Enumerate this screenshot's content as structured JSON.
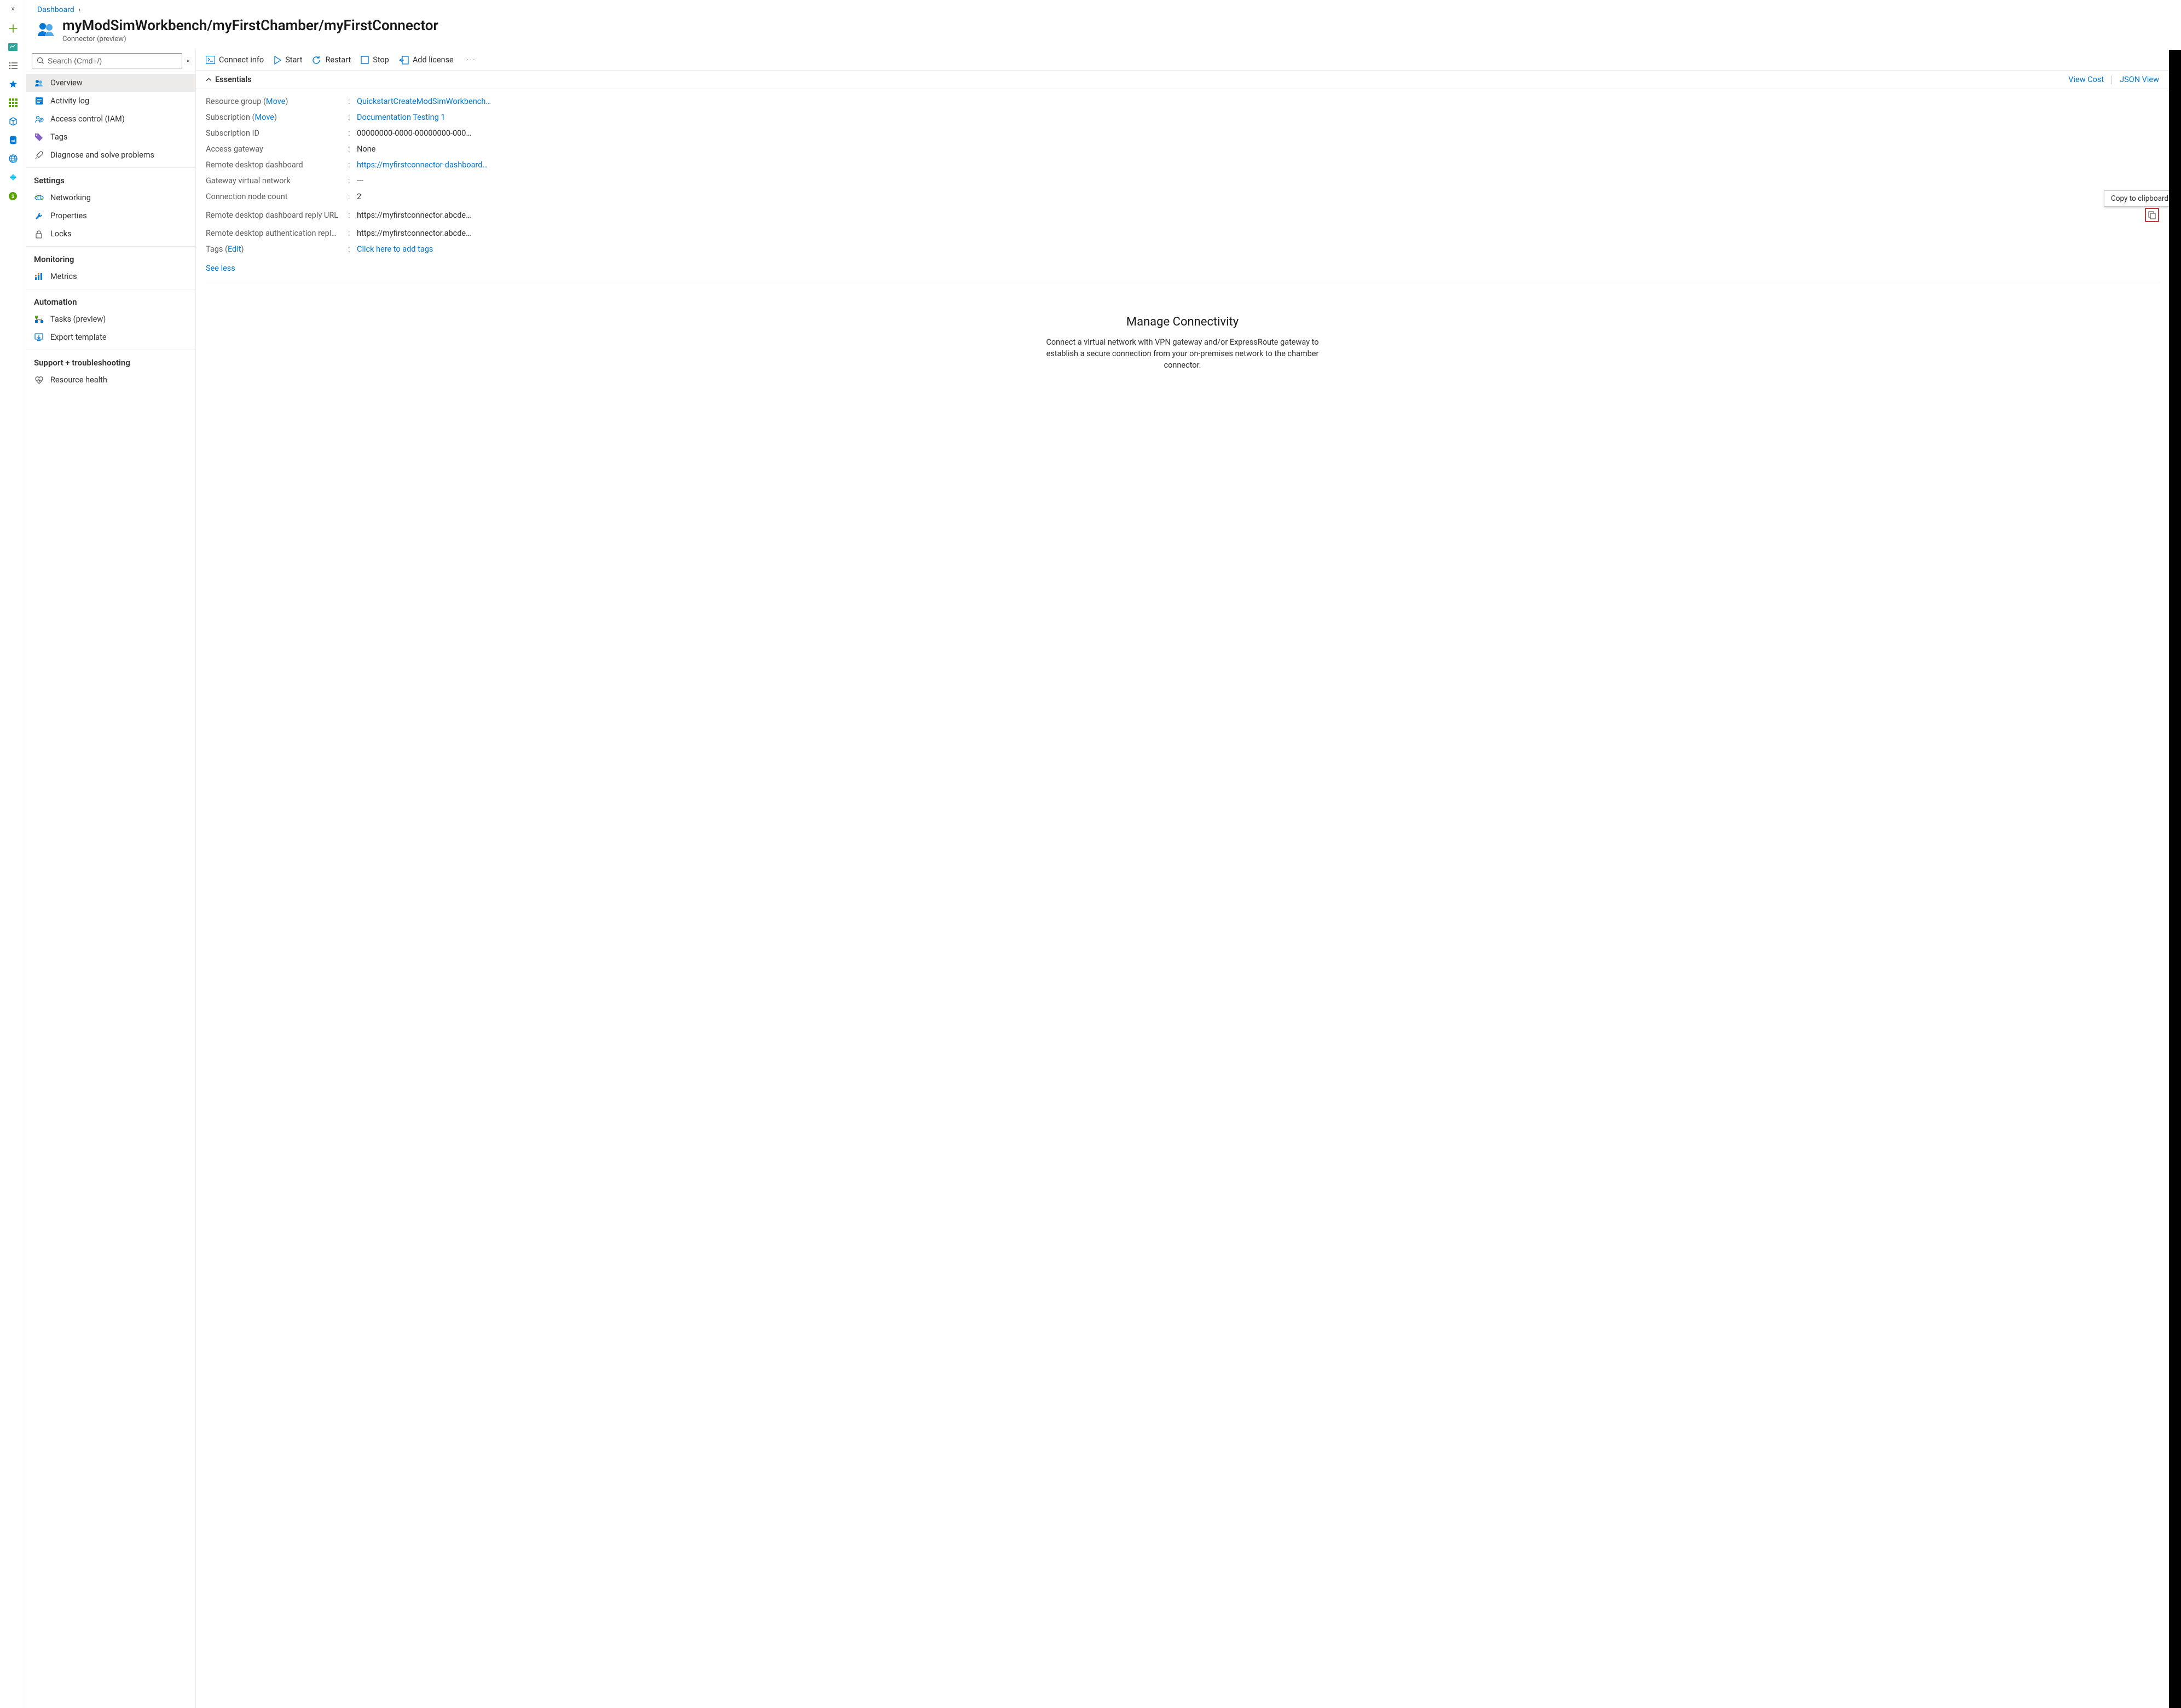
{
  "breadcrumb": {
    "root": "Dashboard"
  },
  "header": {
    "title": "myModSimWorkbench/myFirstChamber/myFirstConnector",
    "subtitle": "Connector (preview)"
  },
  "search": {
    "placeholder": "Search (Cmd+/)"
  },
  "sidebar": {
    "items_top": [
      {
        "label": "Overview",
        "icon": "overview",
        "active": true
      },
      {
        "label": "Activity log",
        "icon": "activity"
      },
      {
        "label": "Access control (IAM)",
        "icon": "iam"
      },
      {
        "label": "Tags",
        "icon": "tags"
      },
      {
        "label": "Diagnose and solve problems",
        "icon": "diagnose"
      }
    ],
    "settings_heading": "Settings",
    "items_settings": [
      {
        "label": "Networking",
        "icon": "networking"
      },
      {
        "label": "Properties",
        "icon": "properties"
      },
      {
        "label": "Locks",
        "icon": "locks"
      }
    ],
    "monitoring_heading": "Monitoring",
    "items_monitoring": [
      {
        "label": "Metrics",
        "icon": "metrics"
      }
    ],
    "automation_heading": "Automation",
    "items_automation": [
      {
        "label": "Tasks (preview)",
        "icon": "tasks"
      },
      {
        "label": "Export template",
        "icon": "export"
      }
    ],
    "support_heading": "Support + troubleshooting",
    "items_support": [
      {
        "label": "Resource health",
        "icon": "health"
      }
    ]
  },
  "toolbar": {
    "connect": "Connect info",
    "start": "Start",
    "restart": "Restart",
    "stop": "Stop",
    "license": "Add license"
  },
  "essentials": {
    "heading": "Essentials",
    "view_cost": "View Cost",
    "json_view": "JSON View",
    "rows": [
      {
        "label": "Resource group",
        "move": "Move",
        "value": "QuickstartCreateModSimWorkbench…",
        "link": true
      },
      {
        "label": "Subscription",
        "move": "Move",
        "value": "Documentation Testing 1",
        "link": true
      },
      {
        "label": "Subscription ID",
        "value": "00000000-0000-00000000-000…"
      },
      {
        "label": "Access gateway",
        "value": "None"
      },
      {
        "label": "Remote desktop dashboard",
        "value": "https://myfirstconnector-dashboard…",
        "link": true
      },
      {
        "label": "Gateway virtual network",
        "value": "---"
      },
      {
        "label": "Connection node count",
        "value": "2"
      },
      {
        "label": "Remote desktop dashboard reply URL",
        "value": "https://myfirstconnector.abcde…",
        "copy": true
      },
      {
        "label": "Remote desktop authentication repl…",
        "value": "https://myfirstconnector.abcde…"
      },
      {
        "label": "Tags",
        "edit": "Edit",
        "value": "Click here to add tags",
        "link": true
      }
    ],
    "see_less": "See less",
    "tooltip": "Copy to clipboard"
  },
  "connectivity": {
    "heading": "Manage Connectivity",
    "body": "Connect a virtual network with VPN gateway and/or ExpressRoute gateway to establish a secure connection from your on-premises network to the chamber connector."
  }
}
